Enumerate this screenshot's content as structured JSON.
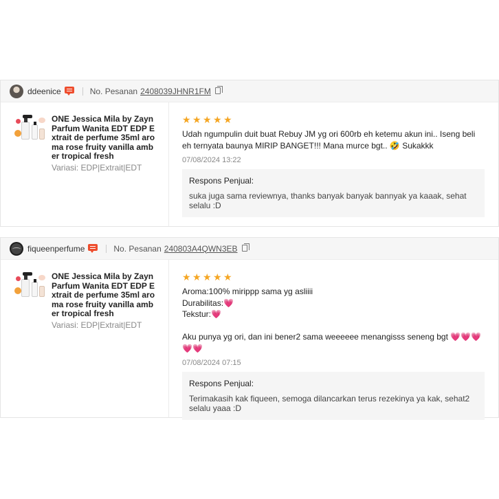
{
  "reviews": [
    {
      "username": "ddeenice",
      "order_label": "No. Pesanan",
      "order_number": "2408039JHNR1FM",
      "product_name": "ONE Jessica Mila by Zayn Parfum Wanita EDT EDP Extrait de perfume 35ml aroma rose fruity vanilla amber tropical fresh",
      "variation": "Variasi: EDP|Extrait|EDT",
      "rating": 5,
      "text": "Udah ngumpulin duit buat Rebuy JM yg ori 600rb eh ketemu akun ini.. Iseng beli eh ternyata baunya MIRIP BANGET!!! Mana murce bgt.. 🤣 Sukakkk",
      "date": "07/08/2024 13:22",
      "response_title": "Respons Penjual:",
      "response_text": "suka juga sama reviewnya, thanks banyak banyak bannyak ya kaaak, sehat selalu :D"
    },
    {
      "username": "fiqueenperfume",
      "order_label": "No. Pesanan",
      "order_number": "240803A4QWN3EB",
      "product_name": "ONE Jessica Mila by Zayn Parfum Wanita EDT EDP Extrait de perfume 35ml aroma rose fruity vanilla amber tropical fresh",
      "variation": "Variasi: EDP|Extrait|EDT",
      "rating": 5,
      "text": "Aroma:100% mirippp sama yg asliiii\nDurabilitas:💗\nTekstur:💗\n\nAku punya yg ori, dan ini bener2 sama weeeeee menangisss seneng bgt 💗💗💗💗💗",
      "date": "07/08/2024 07:15",
      "response_title": "Respons Penjual:",
      "response_text": "Terimakasih kak fiqueen, semoga dilancarkan terus rezekinya ya kak, sehat2 selalu yaaa :D"
    }
  ],
  "icons": {
    "chat": "chat-icon",
    "copy": "copy-icon",
    "star": "star-icon"
  },
  "colors": {
    "star": "#f5a623",
    "chat": "#ee4d2d"
  }
}
